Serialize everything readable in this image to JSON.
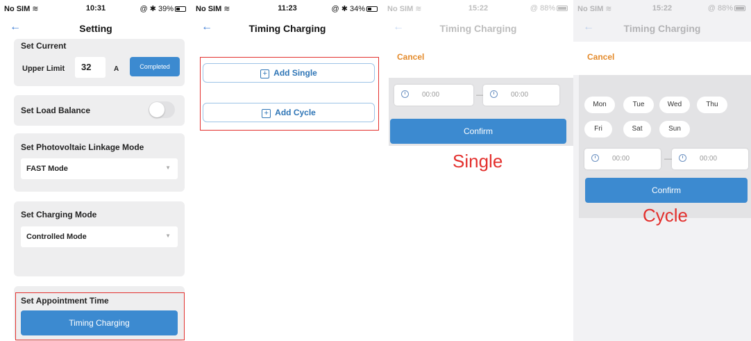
{
  "panel1": {
    "status": {
      "carrier": "No SIM",
      "time": "10:31",
      "right": "@ ✱ 39%",
      "battery": 0.39
    },
    "nav_title": "Setting",
    "set_current": "Set Current",
    "upper_limit_label": "Upper Limit",
    "upper_limit_value": "32",
    "unit": "A",
    "completed_label": "Completed",
    "load_balance_label": "Set Load Balance",
    "load_balance_on": false,
    "pv_mode_label": "Set Photovoltaic Linkage Mode",
    "pv_mode_value": "FAST Mode",
    "charging_mode_label": "Set Charging Mode",
    "charging_mode_value": "Controlled Mode",
    "appointment_label": "Set Appointment Time",
    "timing_button": "Timing Charging"
  },
  "panel2": {
    "status": {
      "carrier": "No SIM",
      "time": "11:23",
      "right": "@ ✱ 34%",
      "battery": 0.34
    },
    "nav_title": "Timing Charging",
    "add_single": "Add Single",
    "add_cycle": "Add Cycle"
  },
  "panel3": {
    "status": {
      "carrier": "No SIM",
      "time": "15:22",
      "right": "@ 88%",
      "battery": 0.88
    },
    "nav_title": "Timing Charging",
    "cancel": "Cancel",
    "start_time": "00:00",
    "end_time": "00:00",
    "confirm": "Confirm",
    "label": "Single"
  },
  "panel4": {
    "status": {
      "carrier": "No SIM",
      "time": "15:22",
      "right": "@ 88%",
      "battery": 0.88
    },
    "nav_title": "Timing Charging",
    "cancel": "Cancel",
    "days": [
      "Mon",
      "Tue",
      "Wed",
      "Thu",
      "Fri",
      "Sat",
      "Sun"
    ],
    "start_time": "00:00",
    "end_time": "00:00",
    "confirm": "Confirm",
    "label": "Cycle"
  },
  "colors": {
    "accent": "#3c8ad0",
    "highlight": "#e3302d",
    "cancel": "#e48a2a",
    "card": "#eeeeef"
  },
  "icons": [
    "wifi-icon",
    "battery-icon",
    "back-arrow-icon",
    "plus-icon",
    "clock-icon",
    "caret-down-icon"
  ]
}
